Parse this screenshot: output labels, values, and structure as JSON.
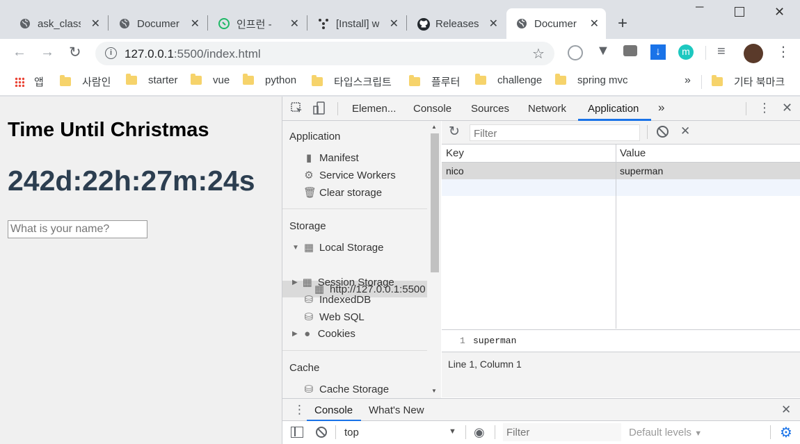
{
  "browser": {
    "tabs": [
      {
        "title": "ask_class",
        "icon": "globe-icon"
      },
      {
        "title": "Documer",
        "icon": "globe-icon"
      },
      {
        "title": "인프런 -",
        "icon": "inflearn-icon"
      },
      {
        "title": "[Install] w",
        "icon": "dots-icon"
      },
      {
        "title": "Releases",
        "icon": "github-icon"
      },
      {
        "title": "Documer",
        "icon": "globe-icon",
        "active": true
      }
    ],
    "address": {
      "host": "127.0.0.1",
      "port_path": ":5500/index.html"
    },
    "bookmarks": [
      "앱",
      "사람인",
      "starter",
      "vue",
      "python",
      "타입스크립트",
      "플루터",
      "challenge",
      "spring mvc"
    ],
    "other_bookmarks": "기타 북마크",
    "overflow": "»"
  },
  "page": {
    "heading": "Time Until Christmas",
    "clock": "242d:22h:27m:24s",
    "name_placeholder": "What is your name?"
  },
  "devtools": {
    "tabs": [
      "Elemen...",
      "Console",
      "Sources",
      "Network",
      "Application"
    ],
    "active_tab": "Application",
    "more": "»",
    "sidebar": {
      "application_header": "Application",
      "application_items": [
        "Manifest",
        "Service Workers",
        "Clear storage"
      ],
      "storage_header": "Storage",
      "local_storage": "Local Storage",
      "local_storage_origin": "http://127.0.0.1:5500",
      "storage_items": [
        "Session Storage",
        "IndexedDB",
        "Web SQL",
        "Cookies"
      ],
      "cache_header": "Cache",
      "cache_items": [
        "Cache Storage"
      ]
    },
    "filter_placeholder": "Filter",
    "table": {
      "columns": [
        "Key",
        "Value"
      ],
      "rows": [
        {
          "key": "nico",
          "value": "superman"
        }
      ]
    },
    "preview": {
      "line_number": "1",
      "text": "superman"
    },
    "status": "Line 1, Column 1",
    "drawer": {
      "tabs": [
        "Console",
        "What's New"
      ],
      "context": "top",
      "filter_placeholder": "Filter",
      "levels": "Default levels"
    }
  },
  "colors": {
    "accent": "#1a73e8",
    "clock": "#2c3e50",
    "selected_row": "#dadada"
  }
}
